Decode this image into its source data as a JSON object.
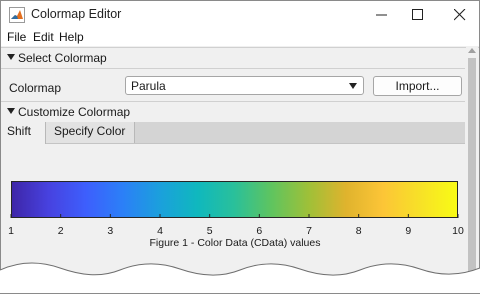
{
  "window": {
    "title": "Colormap Editor",
    "controls": {
      "minimize": "minimize",
      "maximize": "maximize",
      "close": "close"
    }
  },
  "menu": [
    "File",
    "Edit",
    "Help"
  ],
  "select_section": {
    "header": "Select Colormap",
    "colormap_label": "Colormap",
    "colormap_value": "Parula",
    "import_label": "Import..."
  },
  "customize_section": {
    "header": "Customize Colormap",
    "tabs": [
      {
        "label": "Shift",
        "active": true
      },
      {
        "label": "Specify Color",
        "active": false
      }
    ]
  },
  "colorbar": {
    "ticks": [
      "1",
      "2",
      "3",
      "4",
      "5",
      "6",
      "7",
      "8",
      "9",
      "10"
    ],
    "caption": "Figure 1 - Color Data (CData) values",
    "colors": [
      "#3e26a8",
      "#4742e0",
      "#3d5ffd",
      "#2b80f7",
      "#1ba0dc",
      "#0fb8be",
      "#2ac09a",
      "#5fc45f",
      "#9fc038",
      "#dfb32d",
      "#fcc537",
      "#f7e127",
      "#f9fb15"
    ]
  }
}
